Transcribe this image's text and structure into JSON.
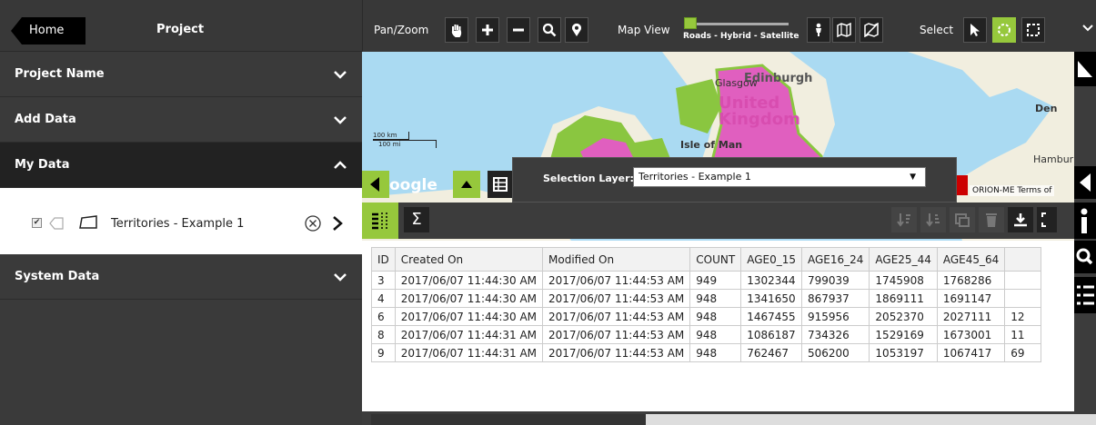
{
  "sidebar": {
    "home_label": "Home",
    "title": "Project",
    "sections": {
      "project_name": "Project Name",
      "add_data": "Add Data",
      "my_data": "My Data",
      "system_data": "System Data"
    },
    "layer": {
      "name": "Territories - Example 1",
      "checked": true
    }
  },
  "toolbar": {
    "pan_zoom_label": "Pan/Zoom",
    "map_view_label": "Map View",
    "map_view_options": "Roads - Hybrid - Satellite",
    "select_label": "Select"
  },
  "map": {
    "place_edinburgh": "Edinburgh",
    "place_glasgow": "Glasgow",
    "place_uk": "United Kingdom",
    "place_isle_of_man": "Isle of Man",
    "place_denmark": "Den",
    "place_hamburg": "Hambur",
    "scale_km": "100 km",
    "scale_mi": "100 mi",
    "google_logo": "oogle",
    "attribution": "ORION-ME  Terms of",
    "accent_color": "#96c83c",
    "region_color": "#e05fbf"
  },
  "selection": {
    "label": "Selection Layer:",
    "value": "Territories - Example 1"
  },
  "data_toolbar": {
    "sum_symbol": "Σ"
  },
  "table": {
    "columns": [
      "ID",
      "Created On",
      "Modified On",
      "COUNT",
      "AGE0_15",
      "AGE16_24",
      "AGE25_44",
      "AGE45_64",
      ""
    ],
    "rows": [
      [
        "3",
        "2017/06/07 11:44:30 AM",
        "2017/06/07 11:44:53 AM",
        "949",
        "1302344",
        "799039",
        "1745908",
        "1768286",
        ""
      ],
      [
        "4",
        "2017/06/07 11:44:30 AM",
        "2017/06/07 11:44:53 AM",
        "948",
        "1341650",
        "867937",
        "1869111",
        "1691147",
        ""
      ],
      [
        "6",
        "2017/06/07 11:44:30 AM",
        "2017/06/07 11:44:53 AM",
        "948",
        "1467455",
        "915956",
        "2052370",
        "2027111",
        "12"
      ],
      [
        "8",
        "2017/06/07 11:44:31 AM",
        "2017/06/07 11:44:53 AM",
        "948",
        "1086187",
        "734326",
        "1529169",
        "1673001",
        "11"
      ],
      [
        "9",
        "2017/06/07 11:44:31 AM",
        "2017/06/07 11:44:53 AM",
        "948",
        "762467",
        "506200",
        "1053197",
        "1067417",
        "69"
      ]
    ]
  }
}
